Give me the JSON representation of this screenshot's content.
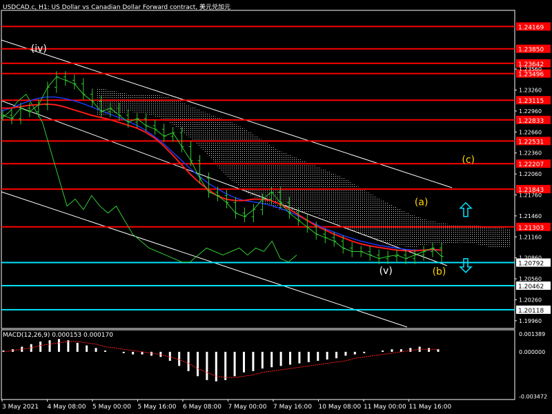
{
  "header": {
    "title": "USDCAD.c, H1:  US Dollar vs Canadian Dollar Forward contract, 美元兑加元",
    "macd_label": "MACD(12,26,9) 0.000153 0.000170"
  },
  "colors": {
    "background": "#000000",
    "frame": "#ffffff",
    "resistance": "#ff0000",
    "support": "#00e5ff",
    "price": "#32cd32",
    "ma_fast": "#ff1a1a",
    "ma_slow": "#1e3cff",
    "cloud": "#ffffff",
    "wave_label": "#ffd700",
    "wave_label_white": "#ffffff",
    "channel": "#ffffff",
    "macd_signal": "#ff2020",
    "macd_hist": "#ffffff"
  },
  "chart_data": {
    "type": "line",
    "symbol": "USDCAD.c",
    "timeframe": "H1",
    "ylim": [
      1.1985,
      1.244
    ],
    "price_scale_ticks": [
      "1.23560",
      "1.23260",
      "1.22960",
      "1.22660",
      "1.22360",
      "1.22060",
      "1.21760",
      "1.21460",
      "1.21160",
      "1.20860",
      "1.20560",
      "1.20260",
      "1.19960"
    ],
    "x_ticks": [
      "3 May 2021",
      "4 May 08:00",
      "5 May 00:00",
      "5 May 16:00",
      "6 May 08:00",
      "7 May 00:00",
      "7 May 16:00",
      "10 May 08:00",
      "11 May 00:00",
      "11 May 16:00"
    ],
    "resistance_levels": [
      {
        "label": "1.24169",
        "value": 1.24169
      },
      {
        "label": "1.23850",
        "value": 1.2385
      },
      {
        "label": "1.23642",
        "value": 1.23642
      },
      {
        "label": "1.23496",
        "value": 1.23496
      },
      {
        "label": "1.23115",
        "value": 1.23115
      },
      {
        "label": "1.22833",
        "value": 1.22833
      },
      {
        "label": "1.22531",
        "value": 1.22531
      },
      {
        "label": "1.22207",
        "value": 1.22207
      },
      {
        "label": "1.21843",
        "value": 1.21843
      },
      {
        "label": "1.21303",
        "value": 1.21303
      }
    ],
    "support_levels": [
      {
        "label": "1.20792",
        "value": 1.20792
      },
      {
        "label": "1.20462",
        "value": 1.20462
      },
      {
        "label": "1.20118",
        "value": 1.20118
      }
    ],
    "wave_labels": [
      {
        "text": "(iv)",
        "x": 5,
        "y": 1.2381,
        "color": "white"
      },
      {
        "text": "(c)",
        "x": 78,
        "y": 1.2222,
        "color": "gold"
      },
      {
        "text": "(a)",
        "x": 70,
        "y": 1.2161,
        "color": "gold"
      },
      {
        "text": "(v)",
        "x": 64,
        "y": 1.2063,
        "color": "white"
      },
      {
        "text": "(b)",
        "x": 73,
        "y": 1.2062,
        "color": "gold"
      }
    ],
    "arrows": [
      {
        "name": "up-arrow",
        "direction": "up",
        "x": 76,
        "y": 1.2155
      },
      {
        "name": "down-arrow",
        "direction": "down",
        "x": 76,
        "y": 1.2075
      }
    ],
    "price": [
      1.229,
      1.2285,
      1.23,
      1.2295,
      1.2305,
      1.233,
      1.2345,
      1.234,
      1.2335,
      1.232,
      1.231,
      1.2295,
      1.23,
      1.229,
      1.228,
      1.2285,
      1.2275,
      1.227,
      1.226,
      1.2265,
      1.2245,
      1.2225,
      1.22,
      1.218,
      1.2175,
      1.2165,
      1.215,
      1.2145,
      1.2155,
      1.217,
      1.218,
      1.2165,
      1.215,
      1.214,
      1.213,
      1.212,
      1.2115,
      1.211,
      1.21,
      1.2095,
      1.2095,
      1.209,
      1.2085,
      1.2088,
      1.209,
      1.2085,
      1.209,
      1.2095,
      1.21,
      1.2088
    ],
    "ma_fast": [
      1.23,
      1.23,
      1.2302,
      1.2304,
      1.2305,
      1.2306,
      1.2305,
      1.2302,
      1.2298,
      1.2294,
      1.229,
      1.2287,
      1.2284,
      1.228,
      1.2276,
      1.2272,
      1.2266,
      1.2258,
      1.2247,
      1.2234,
      1.222,
      1.2206,
      1.2194,
      1.2184,
      1.2175,
      1.217,
      1.2168,
      1.2168,
      1.217,
      1.217,
      1.2168,
      1.2163,
      1.2156,
      1.2148,
      1.214,
      1.2132,
      1.2126,
      1.212,
      1.2115,
      1.211,
      1.2106,
      1.2103,
      1.2101,
      1.2099,
      1.2097,
      1.2096,
      1.2096,
      1.2097,
      1.2098,
      1.2097
    ],
    "ma_slow": [
      1.2296,
      1.23,
      1.2305,
      1.231,
      1.2314,
      1.2316,
      1.2316,
      1.2314,
      1.2311,
      1.2307,
      1.2302,
      1.2297,
      1.2292,
      1.2287,
      1.2282,
      1.2276,
      1.2269,
      1.226,
      1.225,
      1.2238,
      1.2226,
      1.2214,
      1.2203,
      1.2193,
      1.2185,
      1.2178,
      1.2172,
      1.2168,
      1.2166,
      1.2164,
      1.2161,
      1.2157,
      1.2152,
      1.2146,
      1.214,
      1.2134,
      1.2128,
      1.2123,
      1.2118,
      1.2114,
      1.211,
      1.2107,
      1.2104,
      1.2102,
      1.21,
      1.2098,
      1.2097,
      1.2097,
      1.2097,
      1.2097
    ],
    "chikou": [
      1.2285,
      1.2295,
      1.231,
      1.232,
      1.23,
      1.228,
      1.224,
      1.22,
      1.216,
      1.217,
      1.2155,
      1.2175,
      1.216,
      1.215,
      1.216,
      1.214,
      1.212,
      1.211,
      1.21,
      1.2095,
      1.209,
      1.2085,
      1.208,
      1.208,
      1.209,
      1.21,
      1.2095,
      1.209,
      1.2095,
      1.21,
      1.209,
      1.21,
      1.2095,
      1.211,
      1.2085,
      1.208,
      1.209
    ],
    "cloud_upper": [
      1.233,
      1.2325,
      1.232,
      1.232,
      1.2318,
      1.231,
      1.23,
      1.229,
      1.2282,
      1.227,
      1.2255,
      1.224,
      1.223,
      1.222,
      1.221,
      1.22,
      1.2185,
      1.2172,
      1.216,
      1.2148,
      1.214,
      1.2135,
      1.2132,
      1.2132,
      1.213,
      1.2128
    ],
    "cloud_lower": [
      1.229,
      1.2292,
      1.2295,
      1.2292,
      1.2285,
      1.227,
      1.225,
      1.2225,
      1.22,
      1.218,
      1.2165,
      1.2155,
      1.215,
      1.215,
      1.214,
      1.213,
      1.212,
      1.211,
      1.2105,
      1.21,
      1.2105,
      1.2105,
      1.2108,
      1.2105,
      1.21,
      1.2102
    ],
    "macd": {
      "ylim": [
        -0.0035,
        0.0015
      ],
      "ticks": [
        "0.001389",
        "0.000000",
        "-0.003472"
      ],
      "histogram": [
        0.0001,
        0.0002,
        0.0004,
        0.0006,
        0.0008,
        0.0009,
        0.001,
        0.0009,
        0.0007,
        0.0005,
        0.0003,
        0.0001,
        0.0,
        -0.0001,
        -0.0002,
        -0.0002,
        -0.0003,
        -0.0004,
        -0.0007,
        -0.0011,
        -0.0015,
        -0.0019,
        -0.0022,
        -0.0023,
        -0.0022,
        -0.0019,
        -0.0016,
        -0.0015,
        -0.0013,
        -0.0012,
        -0.0011,
        -0.001,
        -0.0009,
        -0.0008,
        -0.0007,
        -0.0006,
        -0.0005,
        -0.0003,
        -0.0002,
        -0.0001,
        0.0,
        0.0001,
        0.0002,
        0.0002,
        0.0003,
        0.0004,
        0.0003,
        0.0002
      ],
      "signal": [
        0.0,
        0.0001,
        0.0002,
        0.0003,
        0.0005,
        0.0006,
        0.0007,
        0.0008,
        0.0008,
        0.0007,
        0.0006,
        0.0004,
        0.0003,
        0.0002,
        0.0001,
        0.0,
        -0.0001,
        -0.0002,
        -0.0004,
        -0.0006,
        -0.0009,
        -0.0013,
        -0.0016,
        -0.0019,
        -0.002,
        -0.002,
        -0.0019,
        -0.0018,
        -0.0016,
        -0.0015,
        -0.0014,
        -0.0013,
        -0.0012,
        -0.0011,
        -0.001,
        -0.0009,
        -0.0008,
        -0.0007,
        -0.0005,
        -0.0004,
        -0.0003,
        -0.0002,
        -0.0001,
        0.0,
        0.0001,
        0.0002,
        0.0002,
        0.0002
      ]
    }
  }
}
